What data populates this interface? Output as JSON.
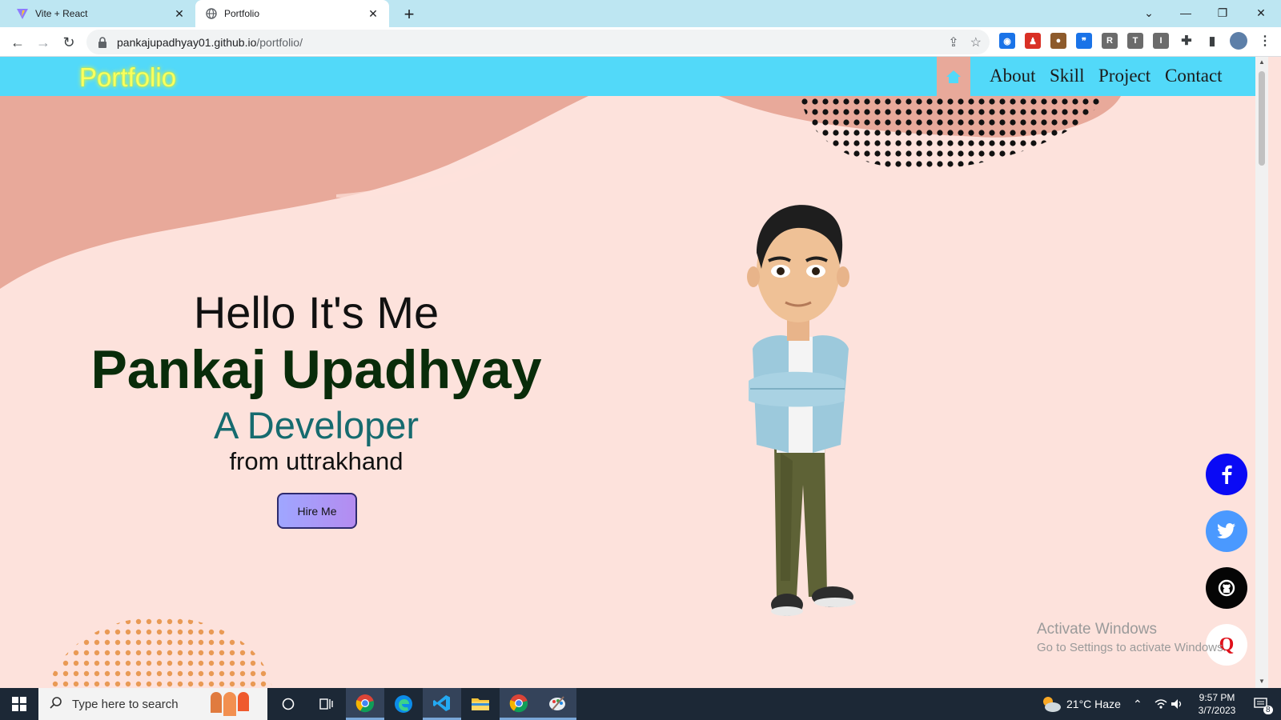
{
  "browser": {
    "tabs": [
      {
        "title": "Vite + React",
        "active": false
      },
      {
        "title": "Portfolio",
        "active": true
      }
    ],
    "url_host": "pankajupadhyay01.github.io",
    "url_path": "/portfolio/"
  },
  "site": {
    "brand": "Portfolio",
    "nav": [
      "About",
      "Skill",
      "Project",
      "Contact"
    ],
    "hero": {
      "greeting": "Hello It's Me",
      "name": "Pankaj Upadhyay",
      "role": "A Developer",
      "origin": "from uttrakhand",
      "cta": "Hire Me"
    },
    "social": [
      "facebook",
      "twitter",
      "github",
      "quora"
    ]
  },
  "watermark": {
    "line1": "Activate Windows",
    "line2": "Go to Settings to activate Windows."
  },
  "taskbar": {
    "search_placeholder": "Type here to search",
    "weather": "21°C  Haze",
    "time": "9:57 PM",
    "date": "3/7/2023",
    "notifications": "8"
  },
  "colors": {
    "nav_bg": "#52d9f9",
    "brand": "#f9ff5e",
    "page_bg": "#fde2dc",
    "blob": "#e8a99a",
    "name": "#092c0a",
    "role": "#166b6f"
  }
}
